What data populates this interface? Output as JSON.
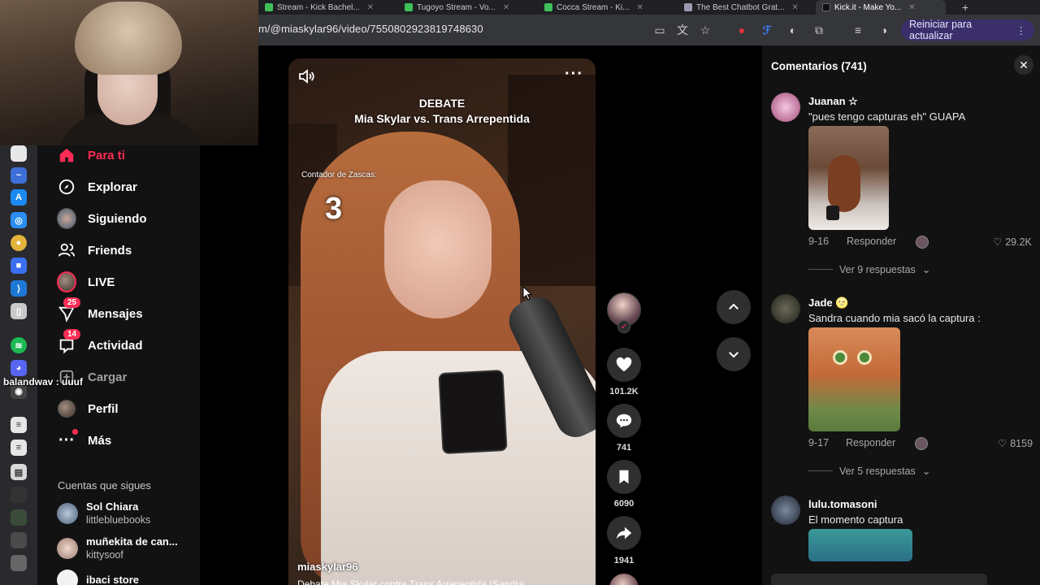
{
  "browser": {
    "tabs": [
      {
        "label": "Stream - Kick Bachel..."
      },
      {
        "label": "Tugoyo Stream - Vo..."
      },
      {
        "label": "Cocca Stream - Ki..."
      },
      {
        "label": "The Best Chatbot Grat..."
      },
      {
        "label": "Kick.it - Make Yo..."
      }
    ],
    "url": "m/@miaskylar96/video/7550802923819748630",
    "update_label": "Reiniciar para actualizar"
  },
  "overlay": {
    "chat_line": "balandwav : uuuf"
  },
  "sidebar": {
    "nav": [
      {
        "label": "Para ti"
      },
      {
        "label": "Explorar"
      },
      {
        "label": "Siguiendo"
      },
      {
        "label": "Friends"
      },
      {
        "label": "LIVE"
      },
      {
        "label": "Mensajes",
        "badge": "25"
      },
      {
        "label": "Actividad",
        "badge": "14"
      },
      {
        "label": "Cargar"
      },
      {
        "label": "Perfil"
      },
      {
        "label": "Más"
      }
    ],
    "following_title": "Cuentas que sigues",
    "following": [
      {
        "name": "Sol Chiara",
        "user": "littlebluebooks"
      },
      {
        "name": "muñekita de can...",
        "user": "kittysoof"
      },
      {
        "name": "ibaci store",
        "user": ""
      }
    ]
  },
  "video": {
    "title_line1": "DEBATE",
    "title_line2": "Mia Skylar vs. Trans Arrepentida",
    "counter_label": "Contador de Zascas:",
    "counter_value": "3",
    "author": "miaskylar96",
    "description": "Debate Mia Skylar contra Trans Arrepentida (Sandra..."
  },
  "actions": {
    "likes": "101.2K",
    "comments": "741",
    "saves": "6090",
    "shares": "1941"
  },
  "comments": {
    "title": "Comentarios (741)",
    "items": [
      {
        "name": "Juanan ☆",
        "text": "\"pues tengo capturas eh\" GUAPA",
        "date": "9-16",
        "reply": "Responder",
        "likes": "29.2K",
        "more": "Ver 9 respuestas"
      },
      {
        "name": "Jade 🌝",
        "text": "Sandra cuando mia sacó la captura :",
        "date": "9-17",
        "reply": "Responder",
        "likes": "8159",
        "more": "Ver 5 respuestas"
      },
      {
        "name": "lulu.tomasoni",
        "text": "El momento captura"
      }
    ]
  },
  "colors": {
    "accent": "#fe2c55",
    "panel": "#121212",
    "update_button": "#3b2f6b"
  }
}
